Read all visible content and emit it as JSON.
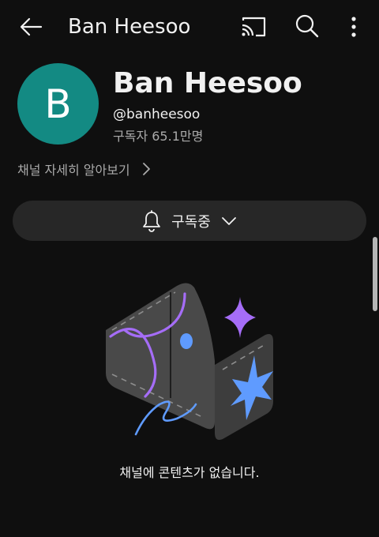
{
  "topbar": {
    "title": "Ban Heesoo",
    "back_icon": "arrow-left-icon",
    "cast_icon": "cast-icon",
    "search_icon": "search-icon",
    "more_icon": "more-vertical-icon"
  },
  "channel": {
    "avatar_letter": "B",
    "avatar_color": "#138a83",
    "name": "Ban Heesoo",
    "handle": "@banheesoo",
    "subscribers": "구독자 65.1만명",
    "info_link": "채널 자세히 알아보기"
  },
  "subscribe": {
    "label": "구독중",
    "bell_icon": "bell-icon",
    "chevron_icon": "chevron-down-icon"
  },
  "empty_state": {
    "illustration": "empty-channel-illustration",
    "message": "채널에 콘텐츠가 없습니다."
  }
}
